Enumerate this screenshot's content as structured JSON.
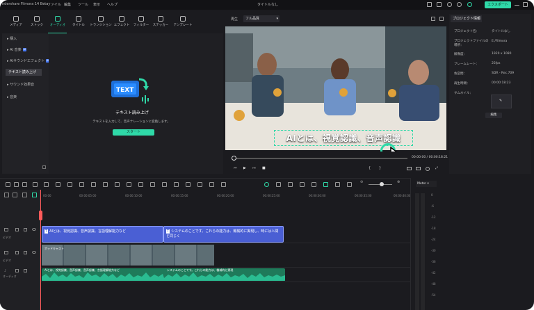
{
  "window": {
    "title": "タイトルなし",
    "app_name": "ndershare Filmora 14 Beta",
    "export_label": "エクスポート"
  },
  "menubar": [
    "ファイル",
    "編集",
    "ツール",
    "表示",
    "ヘルプ"
  ],
  "media_tabs": [
    {
      "label": "メディア",
      "icon": "media-icon",
      "active": false
    },
    {
      "label": "ストック",
      "icon": "stock-icon",
      "active": false
    },
    {
      "label": "オーディオ",
      "icon": "music-note-icon",
      "active": true
    },
    {
      "label": "タイトル",
      "icon": "title-text-icon",
      "active": false
    },
    {
      "label": "トランジション",
      "icon": "transition-icon",
      "active": false
    },
    {
      "label": "エフェクト",
      "icon": "effect-icon",
      "active": false
    },
    {
      "label": "フィルター",
      "icon": "filter-icon",
      "active": false
    },
    {
      "label": "ステッカー",
      "icon": "sticker-icon",
      "active": false
    },
    {
      "label": "テンプレート",
      "icon": "template-icon",
      "active": false
    }
  ],
  "sidebar": {
    "items": [
      {
        "label": "購入",
        "selected": false
      },
      {
        "label": "AI 音楽",
        "badge": "AI",
        "selected": false
      },
      {
        "label": "AIサウンドエフェクト",
        "badge": "AI",
        "selected": false
      },
      {
        "label": "テキスト読み上げ",
        "selected": true
      },
      {
        "label": "サウンド効果音",
        "selected": false
      },
      {
        "label": "音楽",
        "selected": false
      }
    ]
  },
  "tts": {
    "logo_text": "TEXT",
    "title": "テキスト読み上げ",
    "description": "テキストを入力して、音声ナレーションに変換します。",
    "start_label": "スタート"
  },
  "player": {
    "label": "再生",
    "quality": "フル品質",
    "subtitle": "AIとは、視覚認識、音声認識",
    "current_time": "00:00:00",
    "total_time": "00:00:18:21",
    "time_sep": "/"
  },
  "properties": {
    "tab_label": "プロジェクト情報",
    "rows": [
      {
        "label": "プロジェクト名：",
        "value": "タイトルなし"
      },
      {
        "label": "プロジェクトファイルの場所：",
        "value": "E:/Filmora"
      },
      {
        "label": "解像度：",
        "value": "1920 x 1080"
      },
      {
        "label": "フレームレート：",
        "value": "25fps"
      },
      {
        "label": "色空間：",
        "value": "SDR - Rec.709"
      },
      {
        "label": "再生時間：",
        "value": "00:00:18:23"
      },
      {
        "label": "サムネイル：",
        "value": ""
      }
    ],
    "edit_label": "編集"
  },
  "timeline": {
    "ruler": [
      "00:00",
      "00:00:05:00",
      "00:00:10:00",
      "00:00:15:00",
      "00:00:20:00",
      "00:00:25:00",
      "00:00:30:00",
      "00:00:35:00",
      "00:00:40:00"
    ],
    "tracks": [
      {
        "label": "ビデオ"
      },
      {
        "label": "ビデオ"
      },
      {
        "label": "オーディオ"
      }
    ],
    "subtitle_clip1": "AIとは、視覚認識、音声認識、言語理解能力など",
    "subtitle_clip2": "システムのことです。これらの能力は、機械的に実現し、時には人間と同じく",
    "video_clip": "ポッドキャスト",
    "audio_clip1": "AIとは、視覚認識、音声認識、音声認識、言語理解能力など",
    "audio_clip2": "システムのことです。これらの能力は、機械的に実現"
  },
  "meter": {
    "label": "Meter",
    "scale": [
      "0",
      "-6",
      "-12",
      "-18",
      "-24",
      "-30",
      "-36",
      "-42",
      "-48",
      "-54"
    ]
  }
}
